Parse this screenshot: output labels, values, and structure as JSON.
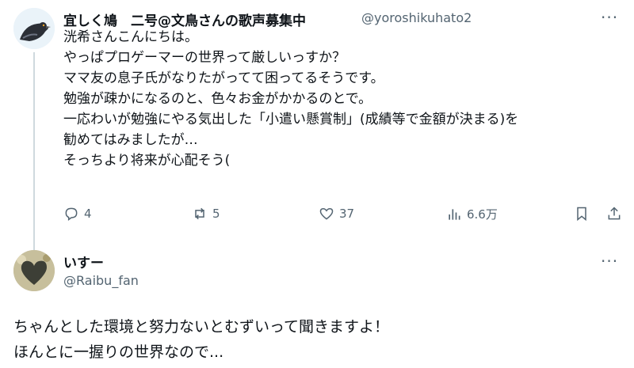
{
  "tweet1": {
    "display_name": "宜しく鳩　二号@文鳥さんの歌声募集中",
    "handle": "@yoroshikuhato2",
    "more_label": "···",
    "lines": [
      "洸希さんこんにちは。",
      "やっぱプロゲーマーの世界って厳しいっすか？",
      "ママ友の息子氏がなりたがってて困ってるそうです。",
      "勉強が疎かになるのと、色々お金がかかるのとで。",
      "一応わいが勉強にやる気出した「小遣い懸賞制」(成績等で金額が決まる)を",
      "勧めてはみましたが…",
      "そっちより将来が心配そう("
    ],
    "actions": {
      "reply_count": "4",
      "repost_count": "5",
      "like_count": "37",
      "views_count": "6.6万"
    }
  },
  "tweet2": {
    "display_name": "いすー",
    "handle": "@Raibu_fan",
    "more_label": "···",
    "lines": [
      "ちゃんとした環境と努力ないとむずいって聞きますよ！",
      "ほんとに一握りの世界なので..."
    ]
  },
  "icons": [
    "pigeon-avatar",
    "reply-icon",
    "repost-icon",
    "like-icon",
    "views-icon",
    "bookmark-icon",
    "share-icon",
    "heart-avatar"
  ],
  "colors": {
    "text": "#0f1419",
    "secondary": "#536471",
    "thread": "#cfd9de"
  }
}
